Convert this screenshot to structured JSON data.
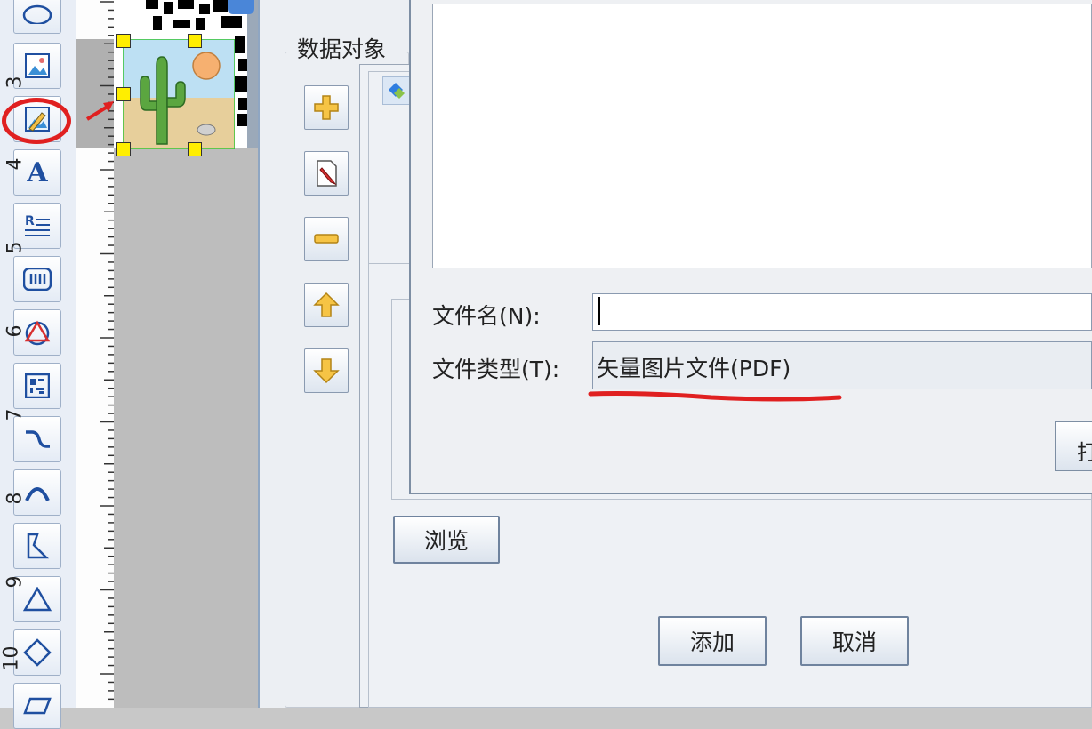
{
  "toolbar": {
    "tools": [
      {
        "name": "ellipse-tool",
        "icon": "ellipse-icon"
      },
      {
        "name": "image-tool",
        "icon": "image-icon"
      },
      {
        "name": "image-import-tool",
        "icon": "image-edit-icon"
      },
      {
        "name": "text-tool",
        "icon": "text-a-icon",
        "glyph": "A"
      },
      {
        "name": "rich-text-tool",
        "icon": "rich-text-icon"
      },
      {
        "name": "barcode-tool",
        "icon": "barcode-icon"
      },
      {
        "name": "shape-tool",
        "icon": "triangle-circle-icon"
      },
      {
        "name": "qrcode-tool",
        "icon": "qrcode-icon"
      },
      {
        "name": "curve-tool",
        "icon": "curve-icon"
      },
      {
        "name": "arc-tool",
        "icon": "arc-icon"
      },
      {
        "name": "polygon-tool",
        "icon": "polygon-icon"
      },
      {
        "name": "triangle-tool",
        "icon": "triangle-icon"
      },
      {
        "name": "diamond-tool",
        "icon": "diamond-icon"
      },
      {
        "name": "parallelogram-tool",
        "icon": "parallelogram-icon"
      }
    ],
    "highlight_color": "#e02020"
  },
  "ruler": {
    "marks": [
      "3",
      "4",
      "5",
      "6",
      "7",
      "8",
      "9",
      "10"
    ]
  },
  "group": {
    "title": "数据对象"
  },
  "file_dialog": {
    "filename_label": "文件名(N):",
    "filename_value": "",
    "filetype_label": "文件类型(T):",
    "filetype_value": "矢量图片文件(PDF)",
    "side_button_partial": "打"
  },
  "data_dialog": {
    "browse_label": "浏览",
    "add_label": "添加",
    "cancel_label": "取消"
  },
  "annotation_color": "#e02020"
}
